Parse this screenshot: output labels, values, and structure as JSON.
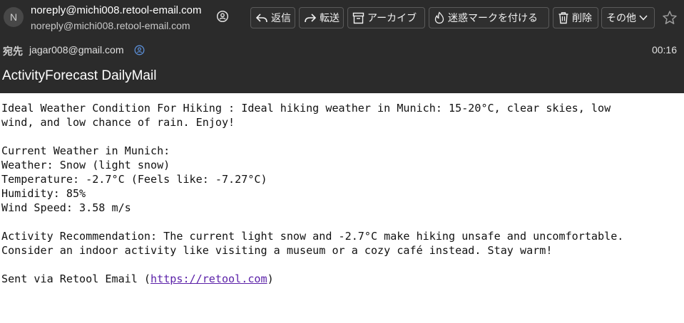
{
  "sender": {
    "avatar_letter": "N",
    "name": "noreply@michi008.retool-email.com",
    "address": "noreply@michi008.retool-email.com"
  },
  "toolbar": {
    "reply": "返信",
    "forward": "転送",
    "archive": "アーカイブ",
    "spam": "迷惑マークを付ける",
    "delete": "削除",
    "more": "その他"
  },
  "recipient": {
    "label": "宛先",
    "address": "jagar008@gmail.com"
  },
  "time": "00:16",
  "subject": "ActivityForecast DailyMail",
  "body": {
    "line1": "Ideal Weather Condition For Hiking : Ideal hiking weather in Munich: 15-20°C, clear skies, low",
    "line2": "wind, and low chance of rain. Enjoy!",
    "line3": "Current Weather in Munich:",
    "line4": "Weather: Snow (light snow)",
    "line5": "Temperature: -2.7°C (Feels like: -7.27°C)",
    "line6": "Humidity: 85%",
    "line7": "Wind Speed: 3.58 m/s",
    "line8": "Activity Recommendation: The current light snow and -2.7°C make hiking unsafe and uncomfortable.",
    "line9": "Consider an indoor activity like visiting a museum or a cozy café instead. Stay warm!",
    "footer_prefix": "Sent via Retool Email (",
    "footer_link": "https://retool.com",
    "footer_suffix": ")"
  },
  "icons": {
    "reply": "reply-icon",
    "forward": "forward-icon",
    "archive": "archive-icon",
    "spam": "spam-icon",
    "delete": "trash-icon",
    "more": "chevron-down-icon",
    "star": "star-icon",
    "contact": "contact-icon"
  }
}
